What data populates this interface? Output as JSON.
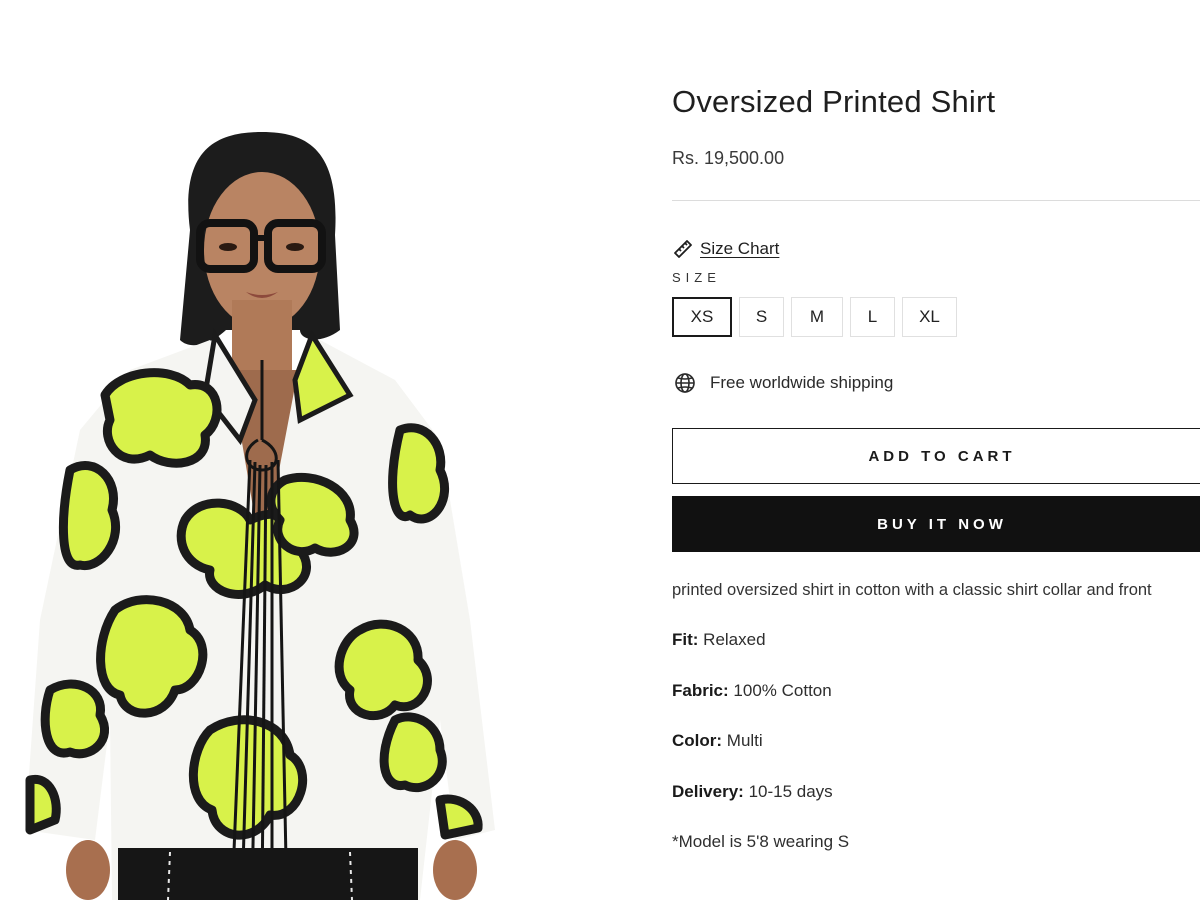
{
  "product": {
    "title": "Oversized Printed Shirt",
    "price": "Rs. 19,500.00",
    "image_alt_icon": "product-photo"
  },
  "size_chart": {
    "label": "Size Chart",
    "icon": "ruler-icon"
  },
  "size_selector": {
    "label": "SIZE",
    "options": [
      "XS",
      "S",
      "M",
      "L",
      "XL"
    ],
    "selected": "XS"
  },
  "shipping": {
    "icon": "globe-icon",
    "text": "Free worldwide shipping"
  },
  "buttons": {
    "add_to_cart": "ADD TO CART",
    "buy_now": "BUY IT NOW"
  },
  "description": "printed oversized shirt in cotton with a classic shirt collar and front",
  "specs": [
    {
      "key": "Fit:",
      "value": "Relaxed"
    },
    {
      "key": "Fabric:",
      "value": "100% Cotton"
    },
    {
      "key": "Color:",
      "value": "Multi"
    },
    {
      "key": "Delivery:",
      "value": "10-15 days"
    }
  ],
  "model_note": "*Model is 5'8 wearing S",
  "colors": {
    "print_green": "#d8f24a",
    "shirt_white": "#f5f5f2",
    "outline_black": "#1b1b1b",
    "button_black": "#111111"
  }
}
